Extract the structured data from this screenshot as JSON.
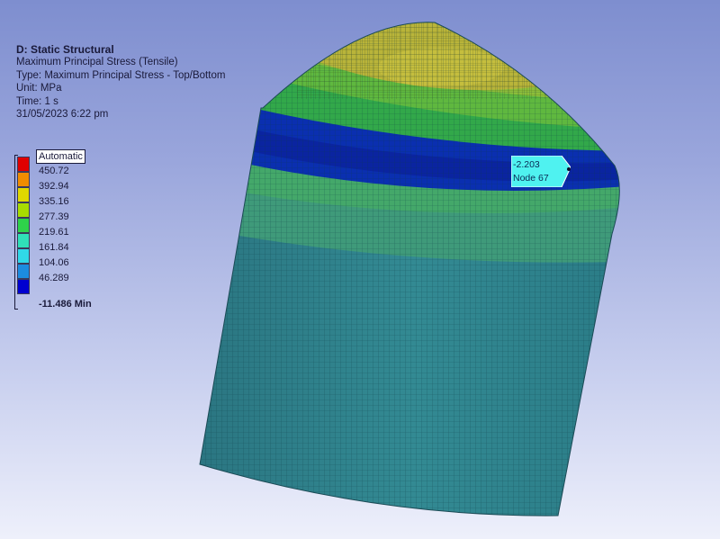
{
  "analysis": {
    "system": "D: Static Structural",
    "result": "Maximum Principal Stress (Tensile)",
    "type": "Type: Maximum Principal Stress - Top/Bottom",
    "unit": "Unit: MPa",
    "time": "Time: 1 s",
    "date": "31/05/2023 6:22 pm"
  },
  "legend": {
    "header": "Automatic",
    "entries": [
      {
        "label": "450.72",
        "color": "#e00000"
      },
      {
        "label": "392.94",
        "color": "#f08c00"
      },
      {
        "label": "335.16",
        "color": "#e0d800"
      },
      {
        "label": "277.39",
        "color": "#a8dc00"
      },
      {
        "label": "219.61",
        "color": "#2ed34a"
      },
      {
        "label": "161.84",
        "color": "#30e0b8"
      },
      {
        "label": "104.06",
        "color": "#30d8e8"
      },
      {
        "label": "46.289",
        "color": "#1c8ce0"
      },
      {
        "label": "-11.486 Min",
        "color": "#0000d0"
      }
    ]
  },
  "probe": {
    "value": "-2.203",
    "node": "Node 67",
    "color": "#4ff2f0"
  },
  "colors": {
    "model_body": "#2e7f8a",
    "band_blue": "#0a2fb0",
    "band_green": "#3aa35a",
    "top_yellow": "#b9b43a",
    "mesh_line": "#0b3a44"
  }
}
